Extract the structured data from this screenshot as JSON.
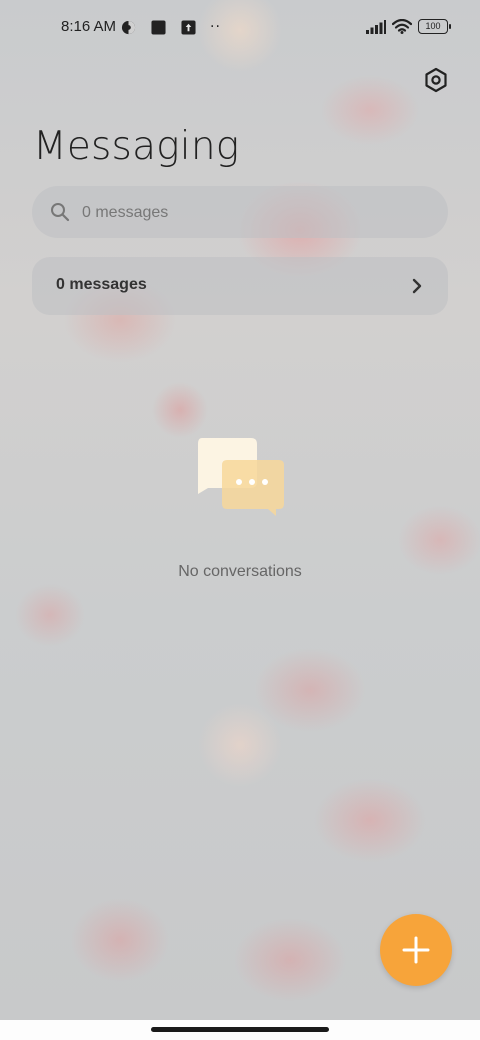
{
  "status_bar": {
    "time": "8:16 AM",
    "battery": "100",
    "left_icons": [
      "app-circle-icon",
      "square-app-icon",
      "upload-icon",
      "more-dots-icon"
    ],
    "right_icons": [
      "signal-icon",
      "wifi-icon",
      "battery-icon"
    ],
    "dots": "··"
  },
  "header": {
    "title": "Messaging",
    "settings_icon": "gear-icon"
  },
  "search": {
    "placeholder": "0 messages",
    "icon": "search-icon"
  },
  "messages_card": {
    "label": "0 messages",
    "icon": "chevron-right-icon"
  },
  "empty_state": {
    "text": "No conversations",
    "icon": "chat-bubbles-icon"
  },
  "fab": {
    "icon": "plus-icon",
    "color": "#f7a43a"
  },
  "colors": {
    "accent": "#f7a43a"
  }
}
